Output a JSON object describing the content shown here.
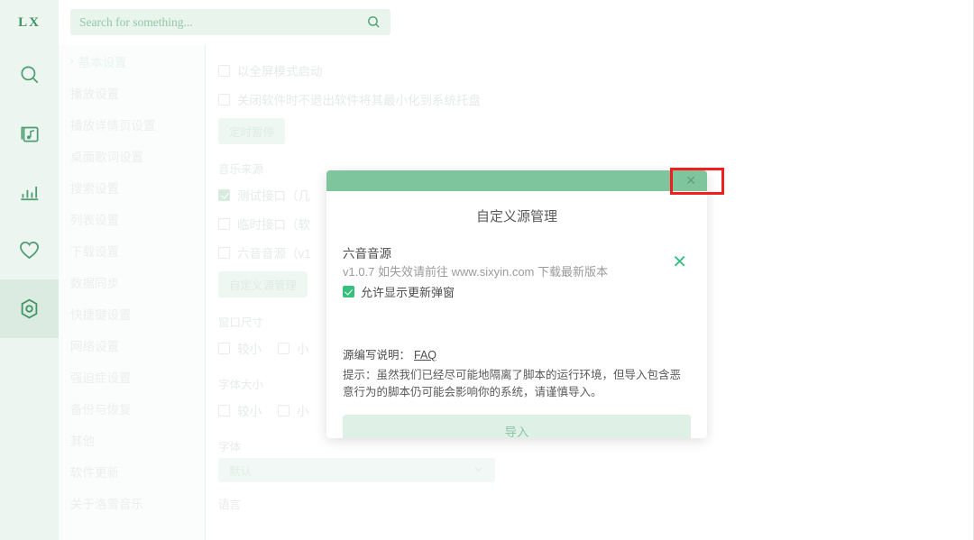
{
  "app": {
    "brand": "LX",
    "window_controls": {
      "minimize": "–",
      "close": "✕"
    }
  },
  "search": {
    "placeholder": "Search for something...",
    "value": "",
    "icon": "search-icon"
  },
  "sidebar_rail": {
    "items": [
      {
        "name": "search-icon",
        "active": false
      },
      {
        "name": "music-library-icon",
        "active": false
      },
      {
        "name": "chart-ranking-icon",
        "active": false
      },
      {
        "name": "heart-favorites-icon",
        "active": false
      },
      {
        "name": "settings-gear-icon",
        "active": true
      }
    ]
  },
  "nav": {
    "items": [
      {
        "label": "基本设置",
        "chevron": "›",
        "selected": true
      },
      {
        "label": "播放设置"
      },
      {
        "label": "播放详情页设置"
      },
      {
        "label": "桌面歌词设置"
      },
      {
        "label": "搜索设置"
      },
      {
        "label": "列表设置"
      },
      {
        "label": "下载设置"
      },
      {
        "label": "数据同步"
      },
      {
        "label": "快捷键设置"
      },
      {
        "label": "网络设置"
      },
      {
        "label": "强迫症设置"
      },
      {
        "label": "备份与恢复"
      },
      {
        "label": "其他"
      },
      {
        "label": "软件更新"
      },
      {
        "label": "关于洛雪音乐"
      }
    ]
  },
  "settings_page": {
    "startup_fullscreen": {
      "label": "以全屏模式启动",
      "checked": false
    },
    "minimize_to_tray": {
      "label": "关闭软件时不退出软件将其最小化到系统托盘",
      "checked": false
    },
    "timed_pause_button": "定时暂停",
    "music_source": {
      "label": "音乐来源",
      "options": [
        {
          "label": "测试接口（几",
          "checked": true
        },
        {
          "label": "临时接口（软",
          "checked": false
        },
        {
          "label": "六音音源（v1",
          "checked": false
        }
      ],
      "manage_button": "自定义源管理"
    },
    "window_size": {
      "label": "窗口尺寸",
      "options": [
        {
          "label": "较小",
          "checked": false
        },
        {
          "label": "小",
          "checked": false
        }
      ]
    },
    "font_size": {
      "label": "字体大小",
      "options": [
        {
          "label": "较小",
          "checked": false
        },
        {
          "label": "小",
          "checked": false
        }
      ]
    },
    "font": {
      "label": "字体",
      "value": "默认",
      "chevron": "⌄"
    },
    "language": {
      "label": "语言"
    }
  },
  "modal": {
    "title": "自定义源管理",
    "close_icon": "✕",
    "source": {
      "name": "六音音源",
      "description": "v1.0.7 如失效请前往 www.sixyin.com 下载最新版本",
      "update_popup": {
        "label": "允许显示更新弹窗",
        "checked": true
      },
      "delete_icon": "✕"
    },
    "faq_label": "源编写说明：",
    "faq_link": "FAQ",
    "tip": "提示：虽然我们已经尽可能地隔离了脚本的运行环境，但导入包含恶意行为的脚本仍可能会影响你的系统，请谨慎导入。",
    "import_button": "导入"
  },
  "annotation": {
    "highlight_target": "modal-close-button",
    "color": "#f21e1e"
  }
}
